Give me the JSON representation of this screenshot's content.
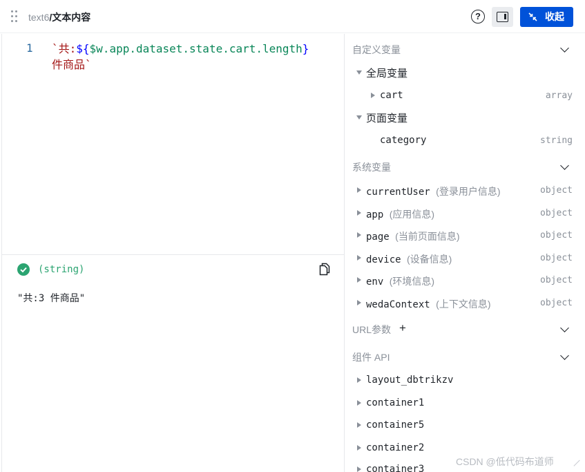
{
  "header": {
    "target_name": "text6",
    "separator": "/",
    "title": "文本内容",
    "help_glyph": "?",
    "collapse_label": "收起"
  },
  "editor": {
    "line_number": "1",
    "code": {
      "tick_open": "`",
      "text_before": "共:",
      "expr_open": "${",
      "expression": "$w.app.dataset.state.cart.length",
      "expr_close": "}",
      "text_after": "件商品",
      "tick_close": "`"
    }
  },
  "result": {
    "type_label": "(string)",
    "value": "\"共:3 件商品\""
  },
  "variables": {
    "custom": {
      "title": "自定义变量",
      "global": {
        "label": "全局变量",
        "items": [
          {
            "name": "cart",
            "type": "array"
          }
        ]
      },
      "page": {
        "label": "页面变量",
        "items": [
          {
            "name": "category",
            "type": "string"
          }
        ]
      }
    },
    "system": {
      "title": "系统变量",
      "items": [
        {
          "name": "currentUser",
          "desc": "(登录用户信息)",
          "type": "object"
        },
        {
          "name": "app",
          "desc": "(应用信息)",
          "type": "object"
        },
        {
          "name": "page",
          "desc": "(当前页面信息)",
          "type": "object"
        },
        {
          "name": "device",
          "desc": "(设备信息)",
          "type": "object"
        },
        {
          "name": "env",
          "desc": "(环境信息)",
          "type": "object"
        },
        {
          "name": "wedaContext",
          "desc": "(上下文信息)",
          "type": "object"
        }
      ]
    },
    "url_params": {
      "title": "URL参数",
      "add_glyph": "+"
    },
    "component_api": {
      "title": "组件 API",
      "items": [
        {
          "name": "layout_dbtrikzv"
        },
        {
          "name": "container1"
        },
        {
          "name": "container5"
        },
        {
          "name": "container2"
        },
        {
          "name": "container3"
        }
      ]
    }
  },
  "watermark": "CSDN @低代码布道师",
  "colors": {
    "primary": "#0052d9",
    "success": "#2ba471",
    "muted": "#8a9099",
    "string_token": "#a31515",
    "expression_token": "#098658"
  }
}
